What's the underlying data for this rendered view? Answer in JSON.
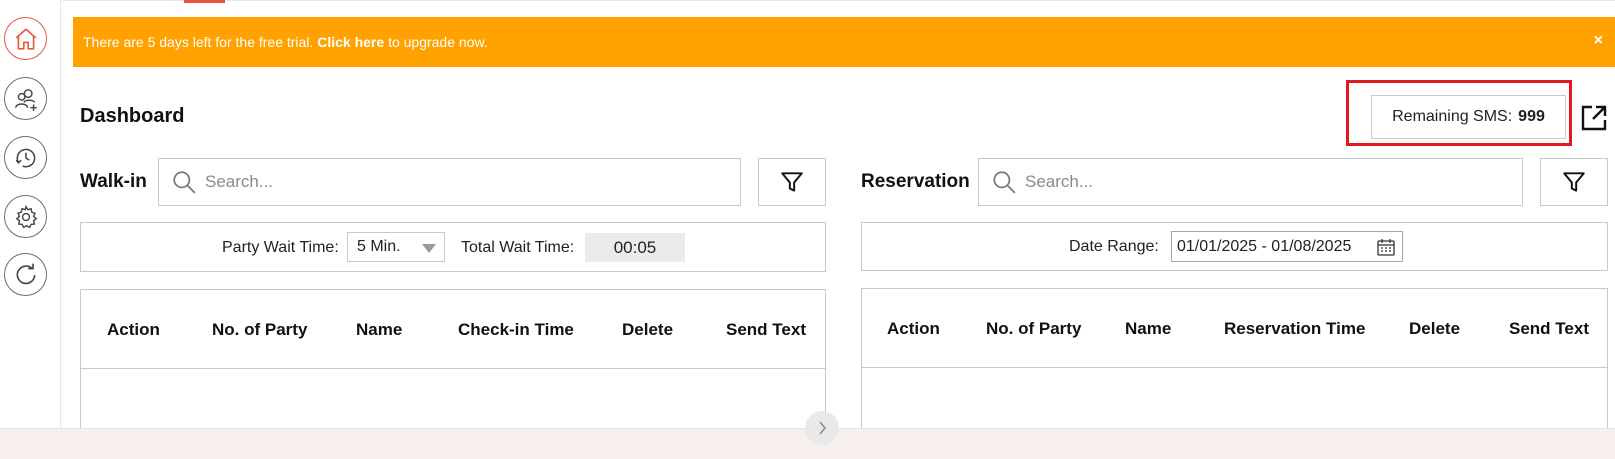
{
  "banner": {
    "text_before": "There are 5 days left for the free trial.",
    "link_text": "Click here",
    "text_after": "to upgrade now.",
    "close_label": "×",
    "color": "#ffa200"
  },
  "page": {
    "title": "Dashboard"
  },
  "sms": {
    "label": "Remaining SMS:",
    "count": "999",
    "highlight_color": "#e1181f"
  },
  "sidebar": {
    "items": [
      {
        "icon": "home-icon",
        "active": true
      },
      {
        "icon": "add-user-icon",
        "active": false
      },
      {
        "icon": "history-icon",
        "active": false
      },
      {
        "icon": "gear-icon",
        "active": false
      },
      {
        "icon": "refresh-icon",
        "active": false
      }
    ],
    "accent_color": "#e8563f"
  },
  "walkin": {
    "label": "Walk-in",
    "search_placeholder": "Search...",
    "party_wait_label": "Party Wait Time:",
    "party_wait_value": "5 Min.",
    "total_wait_label": "Total Wait Time:",
    "total_wait_value": "00:05",
    "columns": [
      "Action",
      "No. of Party",
      "Name",
      "Check-in Time",
      "Delete",
      "Send Text"
    ]
  },
  "reservation": {
    "label": "Reservation",
    "search_placeholder": "Search...",
    "date_range_label": "Date Range:",
    "date_range_value": "01/01/2025 - 01/08/2025",
    "columns": [
      "Action",
      "No. of Party",
      "Name",
      "Reservation Time",
      "Delete",
      "Send Text"
    ]
  }
}
